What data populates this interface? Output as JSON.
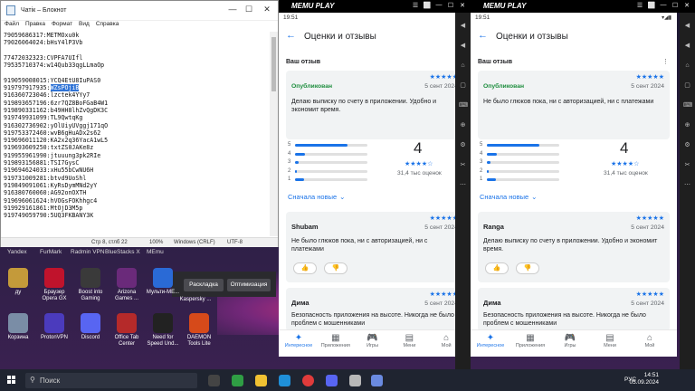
{
  "notepad": {
    "title": "Чатік – Блокнот",
    "menu": [
      "Файл",
      "Правка",
      "Формат",
      "Вид",
      "Справка"
    ],
    "lines": [
      "79059686317:METMOxu0k",
      "79026064024:bHsY4lP3Vb",
      "",
      "77472032323:CVPFA7UIfl",
      "79535710374:w14Qub33qgLLmaOp",
      "",
      "919059008015:YCQ4EtU8IuPAS0",
      "919797917935:",
      "916360723046:lzctek4YYy7",
      "919893657196:6zr7QZ8BoFGaB4W1",
      "919890331162:b49HH8lhZvQgDK3C",
      "919749931099:TL9QwtqKg",
      "916302736902:yOlUiyUVggj171qO",
      "919753372460:wvB6gHuADx2s62",
      "919696011120:KA2x2q36YacA1wL5",
      "919693609250:txtZS0JAKe8z",
      "919955961990:jtuuung3pk2RIe",
      "919893156881:TSI7GysC",
      "919694624033:xHu55bCwNU6H",
      "919731009281:btvd9UoShl",
      "919849091061:KyRsDymMNd2yY",
      "916380760060:AG92onOXTH",
      "919696061624:hVOGsFOKhhgc4",
      "919929161861:MtOjD3M5p",
      "919749059790:5UQ3FKBANY3K"
    ],
    "highlight": "WZsPOjiB",
    "status": {
      "pos": "Стр 8, стлб 22",
      "zoom": "100%",
      "eol": "Windows (CRLF)",
      "enc": "UTF-8"
    }
  },
  "desktop": {
    "tabs": [
      "Yandex",
      "FurMark",
      "Radmin VPN",
      "BlueStacks X",
      "MEmu"
    ],
    "row1": [
      {
        "label": "ду",
        "color": "#c49a3a"
      },
      {
        "label": "Браузер\nOpera GX",
        "color": "#c0132c"
      },
      {
        "label": "Boost into\nGaming",
        "color": "#3a3a3a"
      },
      {
        "label": "Arizona\nGames ...",
        "color": "#6a2a7a"
      },
      {
        "label": "Мульти-ME...",
        "color": "#2a6ad6"
      },
      {
        "label": "Kaspersky ...",
        "color": "#1a8a5a"
      }
    ],
    "row2": [
      {
        "label": "Корзина",
        "color": "#7a8da6"
      },
      {
        "label": "ProtonVPN",
        "color": "#4b3bbd"
      },
      {
        "label": "Discord",
        "color": "#5865f2"
      },
      {
        "label": "Office Tab\nCenter",
        "color": "#b52a2a"
      },
      {
        "label": "Need for\nSpeed Und...",
        "color": "#222222"
      },
      {
        "label": "DAEMON\nTools Lite",
        "color": "#d64a1a"
      }
    ],
    "buttons": [
      "Раскладка",
      "Оптимизация"
    ]
  },
  "memu": {
    "brand": "MEMU PLAY",
    "time": "19:51",
    "title": "Оценки и отзывы",
    "your_review_label": "Ваш отзыв",
    "published": "Опубликован",
    "stars": "★★★★★",
    "date": "5 сент 2024",
    "rating": "4",
    "rating_stars": "★★★★☆",
    "count": "31,4 тыс оценок",
    "sort": "Сначала новые",
    "rating_rows": [
      "5",
      "4",
      "3",
      "2",
      "1"
    ],
    "rating_fractions": [
      0.72,
      0.14,
      0.05,
      0.03,
      0.12
    ],
    "nav": [
      "Интересное",
      "Приложения",
      "Игры",
      "Мени",
      "Мой"
    ],
    "left": {
      "my_review": "Делаю выписку по счету в приложении. Удобно и экономит время.",
      "r1_name": "Shubam",
      "r1_text": "Не было глюков пока, ни с авторизацией, ни с платежами",
      "r2_name": "Дима",
      "r2_text": "Безопасность приложения на высоте. Никогда не было проблем с мошенниками"
    },
    "right": {
      "my_review": "Не было глюков пока, ни с авторизацией, ни с платежами",
      "r1_name": "Ranga",
      "r1_text": "Делаю выписку по счету в приложении. Удобно и экономит время.",
      "r2_name": "Дима",
      "r2_text": "Безопасность приложения на высоте. Никогда не было проблем с мошенниками"
    }
  },
  "taskbar": {
    "search": "Поиск",
    "lang": "РУС",
    "time": "14:51",
    "date": "05.09.2024"
  }
}
